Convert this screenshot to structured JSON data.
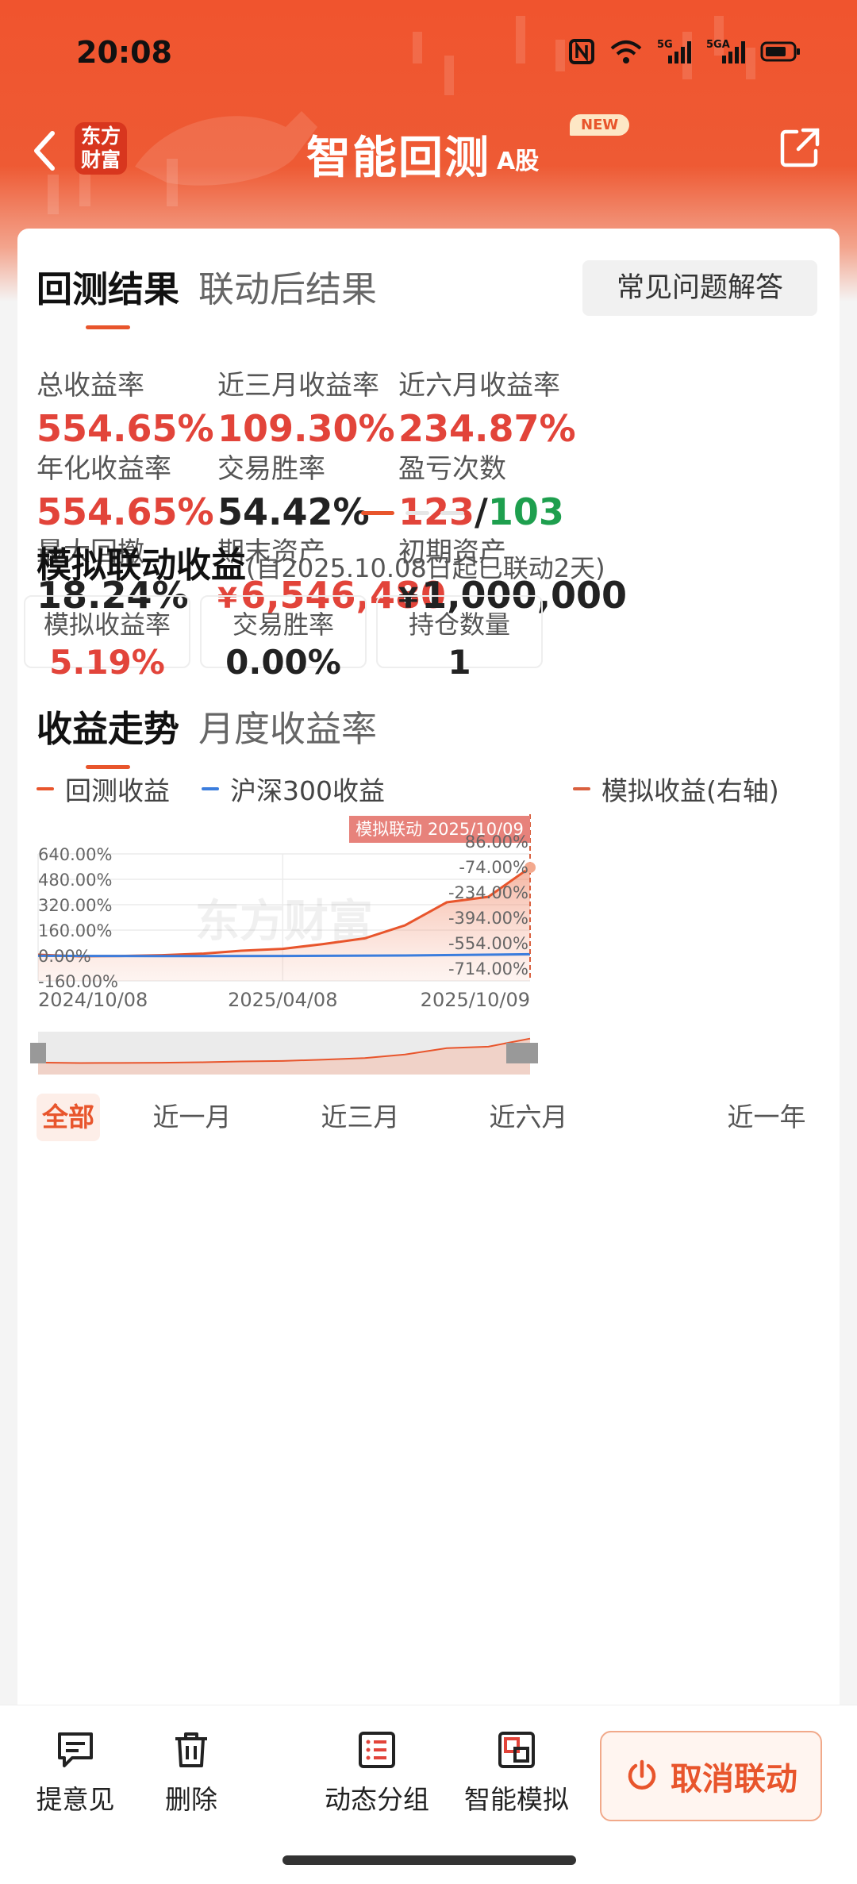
{
  "status_bar": {
    "time": "20:08",
    "net1": "5G",
    "net2": "5GA"
  },
  "nav": {
    "logo_line1": "东方",
    "logo_line2": "财富",
    "title": "智能回测",
    "title_suffix": "A股",
    "badge": "NEW"
  },
  "result_tabs": {
    "active": "回测结果",
    "inactive": "联动后结果"
  },
  "faq_button": "常见问题解答",
  "metrics": [
    {
      "label": "总收益率",
      "value": "554.65%",
      "color": "#e2443a"
    },
    {
      "label": "近三月收益率",
      "value": "109.30%",
      "color": "#e2443a"
    },
    {
      "label": "近六月收益率",
      "value": "234.87%",
      "color": "#e2443a"
    },
    {
      "label": "年化收益率",
      "value": "554.65%",
      "color": "#e2443a"
    },
    {
      "label": "交易胜率",
      "value": "54.42%",
      "color": "#222222"
    },
    {
      "label": "盈亏次数",
      "win": "123",
      "sep": "/",
      "loss": "103"
    },
    {
      "label": "最大回撤",
      "value": "18.24%",
      "color": "#222222"
    },
    {
      "label": "期末资产",
      "currency": "¥",
      "value": "6,546,480",
      "color": "#e2443a"
    },
    {
      "label": "初期资产",
      "currency": "¥",
      "value": "1,000,000",
      "color": "#222222"
    }
  ],
  "sim_section": {
    "title": "模拟联动收益",
    "subtitle": "(自2025.10.08日起已联动2天)",
    "boxes": [
      {
        "label": "模拟收益率",
        "value": "5.19%",
        "color": "#e2443a"
      },
      {
        "label": "交易胜率",
        "value": "0.00%",
        "color": "#222222"
      },
      {
        "label": "持仓数量",
        "value": "1",
        "color": "#222222"
      }
    ]
  },
  "chart_tabs": {
    "active": "收益走势",
    "inactive": "月度收益率"
  },
  "legend": {
    "backtest": "回测收益",
    "hs300": "沪深300收益",
    "sim": "模拟收益(右轴)"
  },
  "colors": {
    "accent": "#e8552c",
    "red": "#e2443a",
    "green": "#1e9f4e",
    "blue": "#3b7ddd"
  },
  "chart_data": {
    "type": "area",
    "tooltip": "模拟联动 2025/10/09",
    "watermark": "东方财富",
    "x_ticks": [
      "2024/10/08",
      "2025/04/08",
      "2025/10/09"
    ],
    "y_left_ticks": [
      "640.00%",
      "480.00%",
      "320.00%",
      "160.00%",
      "0.00%",
      "-160.00%"
    ],
    "y_right_ticks": [
      "86.00%",
      "-74.00%",
      "-234.00%",
      "-394.00%",
      "-554.00%",
      "-714.00%"
    ],
    "ylim_left": [
      -160,
      640
    ],
    "ylim_right": [
      -714,
      86
    ],
    "x_start": "2024/10/08",
    "x_end": "2025/10/09",
    "series": [
      {
        "name": "回测收益",
        "color": "#e8552c",
        "x": [
          "2024/10/08",
          "2024/11/08",
          "2024/12/08",
          "2025/01/08",
          "2025/02/08",
          "2025/03/08",
          "2025/04/08",
          "2025/05/08",
          "2025/06/08",
          "2025/07/08",
          "2025/08/08",
          "2025/09/08",
          "2025/10/09"
        ],
        "values": [
          5,
          -5,
          -3,
          2,
          12,
          30,
          42,
          72,
          108,
          190,
          335,
          370,
          554.65
        ]
      },
      {
        "name": "沪深300收益",
        "color": "#3b7ddd",
        "x": [
          "2024/10/08",
          "2025/01/08",
          "2025/04/08",
          "2025/07/08",
          "2025/10/09"
        ],
        "values": [
          -2,
          -4,
          -3,
          0,
          8
        ]
      }
    ]
  },
  "ranges": [
    "全部",
    "近一月",
    "近三月",
    "近六月",
    "近一年"
  ],
  "toolbar": {
    "feedback": "提意见",
    "delete": "删除",
    "group": "动态分组",
    "sim": "智能模拟",
    "cancel": "取消联动"
  }
}
